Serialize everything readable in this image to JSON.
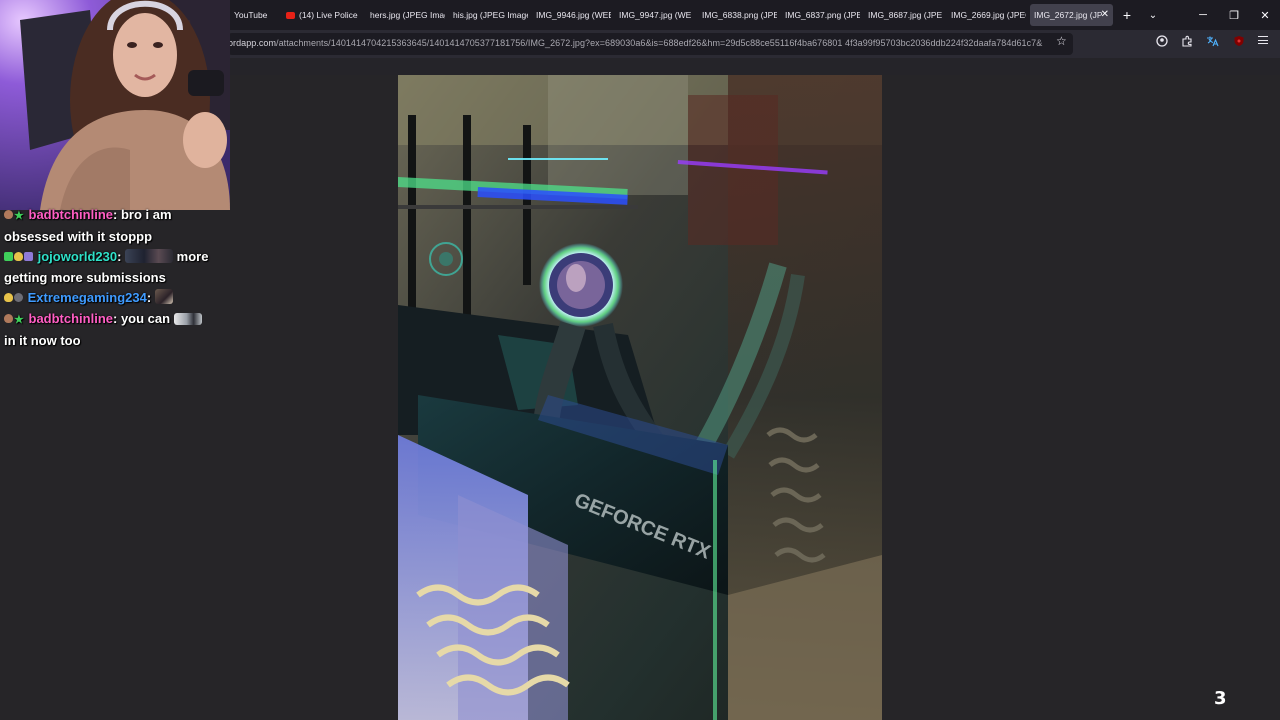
{
  "browser": {
    "tabs": [
      {
        "title": "YouTube",
        "favicon": "none",
        "active": false
      },
      {
        "title": "(14) Live Police",
        "favicon": "youtube-icon",
        "active": false
      },
      {
        "title": "hers.jpg (JPEG Imag",
        "favicon": "none",
        "active": false
      },
      {
        "title": "his.jpg (JPEG Image",
        "favicon": "none",
        "active": false
      },
      {
        "title": "IMG_9946.jpg (WEB",
        "favicon": "none",
        "active": false
      },
      {
        "title": "IMG_9947.jpg (WE",
        "favicon": "none",
        "active": false
      },
      {
        "title": "IMG_6838.png (JPE",
        "favicon": "none",
        "active": false
      },
      {
        "title": "IMG_6837.png (JPE",
        "favicon": "none",
        "active": false
      },
      {
        "title": "IMG_8687.jpg (JPE",
        "favicon": "none",
        "active": false
      },
      {
        "title": "IMG_2669.jpg (JPEG",
        "favicon": "none",
        "active": false
      },
      {
        "title": "IMG_2672.jpg (JP",
        "favicon": "none",
        "active": true
      }
    ],
    "url_host": "ordapp.com",
    "url_path": "/attachments/1401414704215363645/1401414705377181756/IMG_2672.jpg?ex=689030a6&is=688edf26&hm=29d5c88ce55116f4ba676801 4f3a99f95703bc2036ddb224f32daafa784d61c7&"
  },
  "chat": [
    {
      "badges": [
        "brown",
        "green-star"
      ],
      "user": "badbtchinline",
      "user_color": "#ff5ec4",
      "message": "bro i am obsessed with it stoppp"
    },
    {
      "badges": [
        "check",
        "yellow",
        "purple"
      ],
      "user": "jojoworld230",
      "user_color": "#2fe0c8",
      "message": "more getting more submissions"
    },
    {
      "badges": [
        "yellow",
        "grey"
      ],
      "user": "Extremegaming234",
      "user_color": "#3f9bff",
      "message": ""
    },
    {
      "badges": [
        "brown",
        "green-star"
      ],
      "user": "badbtchinline",
      "user_color": "#ff5ec4",
      "message": "you can in it now too"
    }
  ],
  "overlay": {
    "corner_number": "3"
  },
  "colors": {
    "tab_bar": "#1c1b22",
    "nav_bar": "#2b2a33",
    "viewer_bg": "#262528",
    "active_tab": "#42414d"
  }
}
